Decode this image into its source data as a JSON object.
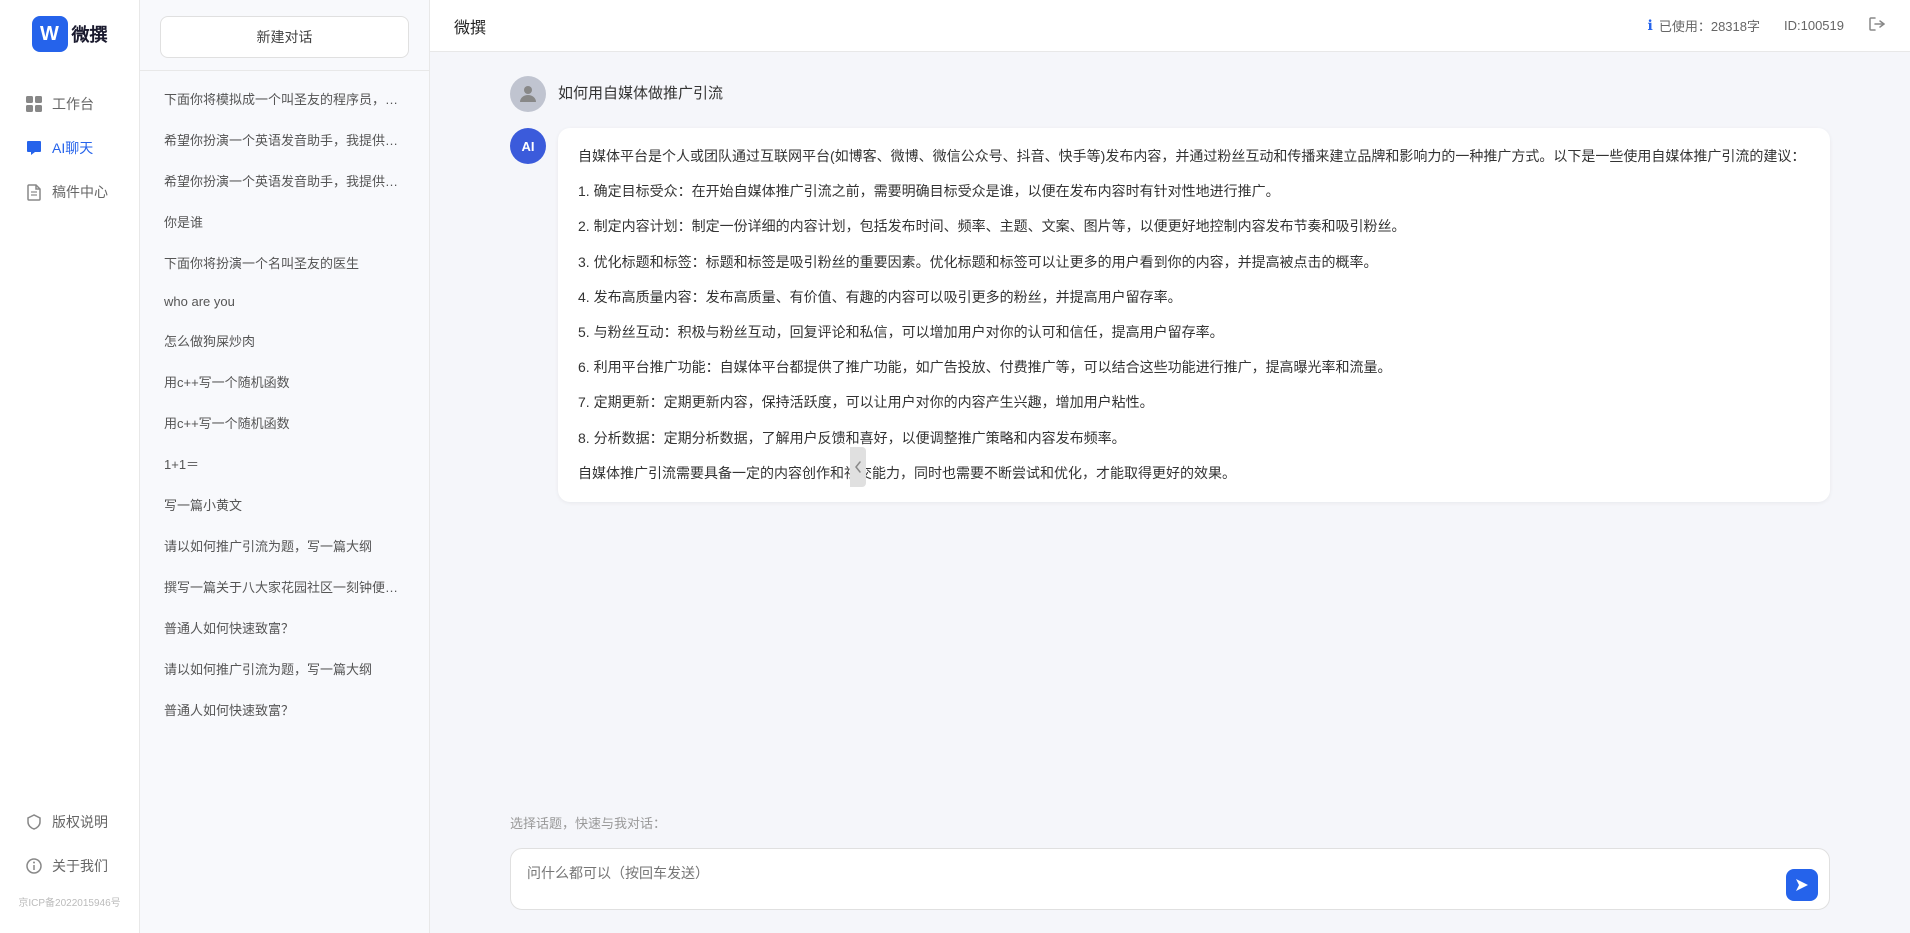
{
  "app": {
    "title": "微撰",
    "logo_letter": "W",
    "logo_text": "微撰",
    "usage_label": "已使用：28318字",
    "id_label": "ID:100519",
    "usage_icon": "ℹ"
  },
  "nav": {
    "items": [
      {
        "id": "workbench",
        "label": "工作台",
        "icon": "grid"
      },
      {
        "id": "ai-chat",
        "label": "AI聊天",
        "icon": "chat",
        "active": true
      },
      {
        "id": "drafts",
        "label": "稿件中心",
        "icon": "file"
      }
    ],
    "bottom_items": [
      {
        "id": "copyright",
        "label": "版权说明",
        "icon": "shield"
      },
      {
        "id": "about",
        "label": "关于我们",
        "icon": "info"
      }
    ],
    "icp": "京ICP备2022015946号"
  },
  "sidebar": {
    "new_chat_label": "新建对话",
    "chat_items": [
      {
        "id": 1,
        "text": "下面你将模拟成一个叫圣友的程序员，我说..."
      },
      {
        "id": 2,
        "text": "希望你扮演一个英语发音助手，我提供给你..."
      },
      {
        "id": 3,
        "text": "希望你扮演一个英语发音助手，我提供给你..."
      },
      {
        "id": 4,
        "text": "你是谁"
      },
      {
        "id": 5,
        "text": "下面你将扮演一个名叫圣友的医生"
      },
      {
        "id": 6,
        "text": "who are you",
        "active": false
      },
      {
        "id": 7,
        "text": "怎么做狗屎炒肉"
      },
      {
        "id": 8,
        "text": "用c++写一个随机函数"
      },
      {
        "id": 9,
        "text": "用c++写一个随机函数"
      },
      {
        "id": 10,
        "text": "1+1＝"
      },
      {
        "id": 11,
        "text": "写一篇小黄文"
      },
      {
        "id": 12,
        "text": "请以如何推广引流为题，写一篇大纲"
      },
      {
        "id": 13,
        "text": "撰写一篇关于八大家花园社区一刻钟便民生..."
      },
      {
        "id": 14,
        "text": "普通人如何快速致富？"
      },
      {
        "id": 15,
        "text": "请以如何推广引流为题，写一篇大纲"
      },
      {
        "id": 16,
        "text": "普通人如何快速致富？"
      }
    ]
  },
  "main": {
    "title": "微撰",
    "user_question": "如何用自媒体做推广引流",
    "ai_response": {
      "paragraphs": [
        "自媒体平台是个人或团队通过互联网平台(如博客、微博、微信公众号、抖音、快手等)发布内容，并通过粉丝互动和传播来建立品牌和影响力的一种推广方式。以下是一些使用自媒体推广引流的建议：",
        "1. 确定目标受众：在开始自媒体推广引流之前，需要明确目标受众是谁，以便在发布内容时有针对性地进行推广。",
        "2. 制定内容计划：制定一份详细的内容计划，包括发布时间、频率、主题、文案、图片等，以便更好地控制内容发布节奏和吸引粉丝。",
        "3. 优化标题和标签：标题和标签是吸引粉丝的重要因素。优化标题和标签可以让更多的用户看到你的内容，并提高被点击的概率。",
        "4. 发布高质量内容：发布高质量、有价值、有趣的内容可以吸引更多的粉丝，并提高用户留存率。",
        "5. 与粉丝互动：积极与粉丝互动，回复评论和私信，可以增加用户对你的认可和信任，提高用户留存率。",
        "6. 利用平台推广功能：自媒体平台都提供了推广功能，如广告投放、付费推广等，可以结合这些功能进行推广，提高曝光率和流量。",
        "7. 定期更新：定期更新内容，保持活跃度，可以让用户对你的内容产生兴趣，增加用户粘性。",
        "8. 分析数据：定期分析数据，了解用户反馈和喜好，以便调整推广策略和内容发布频率。",
        "自媒体推广引流需要具备一定的内容创作和社交能力，同时也需要不断尝试和优化，才能取得更好的效果。"
      ]
    },
    "quick_topics_label": "选择话题，快速与我对话：",
    "input_placeholder": "问什么都可以（按回车发送）"
  }
}
